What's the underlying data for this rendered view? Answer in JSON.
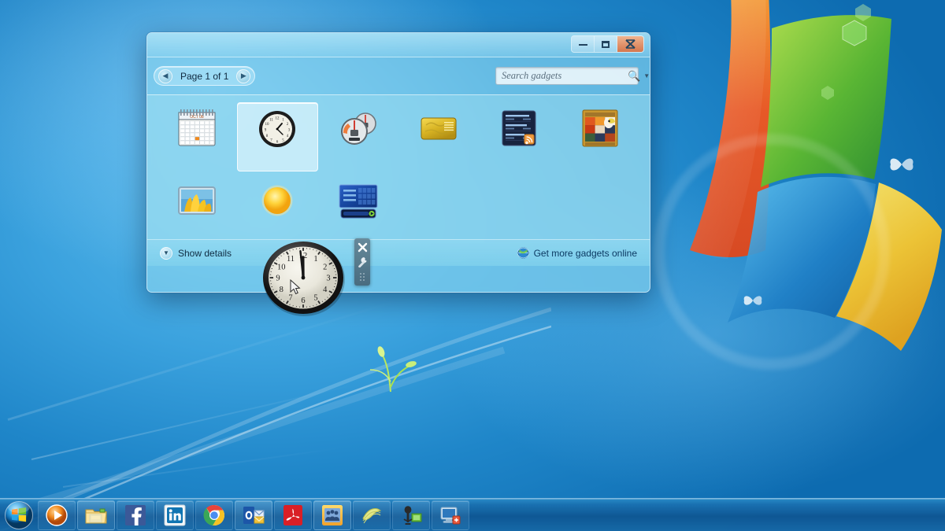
{
  "desktop": {
    "wallpaper_name": "windows-7-harmony-wallpaper",
    "accent_color": "#1f86c9"
  },
  "gallery": {
    "window_title": "",
    "window_controls": [
      {
        "name": "minimize",
        "glyph": "minimize-icon"
      },
      {
        "name": "maximize",
        "glyph": "maximize-icon"
      },
      {
        "name": "close",
        "glyph": "close-icon"
      }
    ],
    "pager": {
      "prev_label": "◀",
      "next_label": "▶",
      "page_text": "Page 1 of 1"
    },
    "search": {
      "placeholder": "Search gadgets",
      "value": "",
      "icon": "search-icon",
      "caret": "chevron-down-icon"
    },
    "gadgets": [
      {
        "label": "Calendar",
        "icon": "calendar-gadget-icon",
        "selected": false
      },
      {
        "label": "Clock",
        "icon": "clock-gadget-icon",
        "selected": true
      },
      {
        "label": "CPU Meter",
        "icon": "cpu-meter-gadget-icon",
        "selected": false
      },
      {
        "label": "Currency",
        "icon": "currency-gadget-icon",
        "selected": false
      },
      {
        "label": "Feed Headlines",
        "icon": "feed-headlines-gadget-icon",
        "selected": false
      },
      {
        "label": "Picture Puzzle",
        "icon": "picture-puzzle-gadget-icon",
        "selected": false
      },
      {
        "label": "Slide Show",
        "icon": "slide-show-gadget-icon",
        "selected": false
      },
      {
        "label": "Weather",
        "icon": "weather-gadget-icon",
        "selected": false
      },
      {
        "label": "Windows Media...",
        "icon": "windows-media-gadget-icon",
        "selected": false
      }
    ],
    "footer": {
      "show_details_label": "Show details",
      "show_details_icon": "chevron-down-icon",
      "more_gadgets_label": "Get more gadgets online",
      "more_gadgets_icon": "globe-icon"
    },
    "calendar_icon_text": {
      "month": "OCT 08"
    }
  },
  "clock_gadget": {
    "name": "desktop-clock-gadget",
    "hour_numerals": [
      "12",
      "1",
      "2",
      "3",
      "4",
      "5",
      "6",
      "7",
      "8",
      "9",
      "10",
      "11"
    ],
    "time": {
      "hours": 11,
      "minutes": 59
    },
    "toolbar": {
      "close_label": "✕",
      "close_icon": "close-icon",
      "options_icon": "wrench-icon",
      "drag_icon": "drag-handle-icon"
    }
  },
  "taskbar": {
    "start_button": {
      "label": "Start",
      "icon": "windows-start-orb-icon"
    },
    "items": [
      {
        "label": "Windows Media Player",
        "icon": "media-player-icon"
      },
      {
        "label": "Windows Explorer",
        "icon": "explorer-folder-icon"
      },
      {
        "label": "Facebook",
        "icon": "facebook-icon"
      },
      {
        "label": "LinkedIn",
        "icon": "linkedin-icon"
      },
      {
        "label": "Google Chrome",
        "icon": "chrome-icon"
      },
      {
        "label": "Microsoft Outlook",
        "icon": "outlook-icon"
      },
      {
        "label": "Adobe Reader",
        "icon": "adobe-reader-icon"
      },
      {
        "label": "Contacts",
        "icon": "people-group-icon"
      },
      {
        "label": "Sticky Notes",
        "icon": "notes-icon"
      },
      {
        "label": "Screen Recorder",
        "icon": "microphone-icon"
      },
      {
        "label": "Remote Desktop",
        "icon": "remote-desktop-icon"
      }
    ]
  }
}
